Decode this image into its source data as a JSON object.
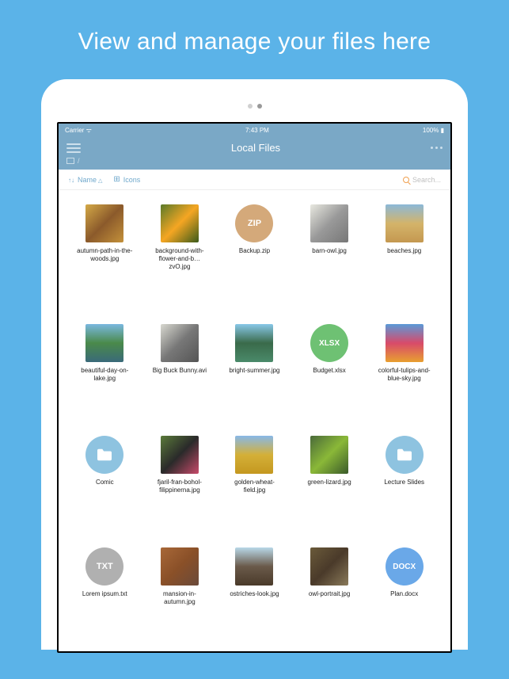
{
  "promo": {
    "title": "View and manage your files here"
  },
  "status": {
    "carrier": "Carrier",
    "time": "7:43 PM",
    "battery": "100%"
  },
  "header": {
    "title": "Local Files"
  },
  "breadcrumb": {
    "path": "/"
  },
  "toolbar": {
    "sort_label": "Name",
    "view_label": "Icons",
    "search_placeholder": "Search..."
  },
  "files": [
    {
      "name": "autumn-path-in-the-woods.jpg",
      "type": "img",
      "bg": "linear-gradient(135deg,#d4a947,#8b5a2b,#c4913a)"
    },
    {
      "name": "background-with-flower-and-b…zvO.jpg",
      "type": "img",
      "bg": "linear-gradient(135deg,#5a7a2a,#f5a623,#3a5a1a)"
    },
    {
      "name": "Backup.zip",
      "type": "zip",
      "label": "ZIP",
      "bg": "#d4a97a"
    },
    {
      "name": "barn-owl.jpg",
      "type": "img",
      "bg": "linear-gradient(135deg,#e8e8e0,#999,#777)"
    },
    {
      "name": "beaches.jpg",
      "type": "img",
      "bg": "linear-gradient(180deg,#8bb8d8,#d4b46a,#c49850)"
    },
    {
      "name": "beautiful-day-on-lake.jpg",
      "type": "img",
      "bg": "linear-gradient(180deg,#7ab8e0,#4a8a4a,#3a6a7a)"
    },
    {
      "name": "Big Buck Bunny.avi",
      "type": "img",
      "bg": "linear-gradient(135deg,#d8d8d0,#777,#555)"
    },
    {
      "name": "bright-summer.jpg",
      "type": "img",
      "bg": "linear-gradient(180deg,#88c8e8,#3a6a4a,#4a8a6a)"
    },
    {
      "name": "Budget.xlsx",
      "type": "xlsx",
      "label": "XLSX",
      "bg": "#6ec173"
    },
    {
      "name": "colorful-tulips-and-blue-sky.jpg",
      "type": "img",
      "bg": "linear-gradient(180deg,#5a9ad8,#d84a6a,#e8a030)"
    },
    {
      "name": "Comic",
      "type": "folder",
      "bg": "#8ec3e0"
    },
    {
      "name": "fjaril-fran-bohol-filippinerna.jpg",
      "type": "img",
      "bg": "linear-gradient(135deg,#5a7a3a,#2a2a2a,#c84a6a)"
    },
    {
      "name": "golden-wheat-field.jpg",
      "type": "img",
      "bg": "linear-gradient(180deg,#88b8e8,#d4b038,#c49820)"
    },
    {
      "name": "green-lizard.jpg",
      "type": "img",
      "bg": "linear-gradient(135deg,#4a6a3a,#8ab838,#3a5a2a)"
    },
    {
      "name": "Lecture Slides",
      "type": "folder",
      "bg": "#8ec3e0"
    },
    {
      "name": "Lorem ipsum.txt",
      "type": "txt",
      "label": "TXT",
      "bg": "#b0b0b0"
    },
    {
      "name": "mansion-in-autumn.jpg",
      "type": "img",
      "bg": "linear-gradient(135deg,#a86838,#8a5028,#6a4a3a)"
    },
    {
      "name": "ostriches-look.jpg",
      "type": "img",
      "bg": "linear-gradient(180deg,#b8d8e8,#6a5a4a,#4a3a2a)"
    },
    {
      "name": "owl-portrait.jpg",
      "type": "img",
      "bg": "linear-gradient(135deg,#6a5a3a,#4a3a2a,#8a7a5a)"
    },
    {
      "name": "Plan.docx",
      "type": "docx",
      "label": "DOCX",
      "bg": "#6aa8e8"
    }
  ]
}
